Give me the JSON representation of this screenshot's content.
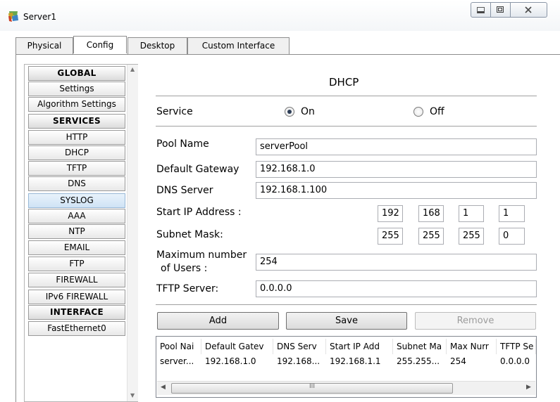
{
  "window": {
    "title": "Server1",
    "icon": "server-app-icon",
    "controls": [
      "minimize-icon",
      "maximize-icon",
      "close-icon"
    ]
  },
  "tabs": [
    {
      "label": "Physical"
    },
    {
      "label": "Config",
      "active": true
    },
    {
      "label": "Desktop"
    },
    {
      "label": "Custom Interface"
    }
  ],
  "sidebar": {
    "items": [
      {
        "label": "GLOBAL",
        "kind": "header"
      },
      {
        "label": "Settings",
        "kind": "item"
      },
      {
        "label": "Algorithm Settings",
        "kind": "item"
      },
      {
        "label": "SERVICES",
        "kind": "header"
      },
      {
        "label": "HTTP",
        "kind": "item"
      },
      {
        "label": "DHCP",
        "kind": "item"
      },
      {
        "label": "TFTP",
        "kind": "item"
      },
      {
        "label": "DNS",
        "kind": "item"
      },
      {
        "label": "SYSLOG",
        "kind": "item"
      },
      {
        "label": "AAA",
        "kind": "item"
      },
      {
        "label": "NTP",
        "kind": "item"
      },
      {
        "label": "EMAIL",
        "kind": "item"
      },
      {
        "label": "FTP",
        "kind": "item"
      },
      {
        "label": "FIREWALL",
        "kind": "item"
      },
      {
        "label": "IPv6 FIREWALL",
        "kind": "item"
      },
      {
        "label": "INTERFACE",
        "kind": "header"
      },
      {
        "label": "FastEthernet0",
        "kind": "item"
      }
    ]
  },
  "dhcp": {
    "heading": "DHCP",
    "service_label": "Service",
    "service_on_label": "On",
    "service_off_label": "Off",
    "service_state": "On",
    "pool_name_label": "Pool Name",
    "pool_name_value": "serverPool",
    "default_gateway_label": "Default Gateway",
    "default_gateway_value": "192.168.1.0",
    "dns_server_label": "DNS Server",
    "dns_server_value": "192.168.1.100",
    "start_ip_label": "Start IP Address :",
    "start_ip_octets": [
      "192",
      "168",
      "1",
      "1"
    ],
    "subnet_mask_label": "Subnet Mask:",
    "subnet_mask_octets": [
      "255",
      "255",
      "255",
      "0"
    ],
    "max_users_label_line1": "Maximum number",
    "max_users_label_line2": "of Users :",
    "max_users_value": "254",
    "tftp_server_label": "TFTP Server:",
    "tftp_server_value": "0.0.0.0",
    "add_button": "Add",
    "save_button": "Save",
    "remove_button": "Remove"
  },
  "pool_table": {
    "columns": [
      "Pool Nai",
      "Default Gatev",
      "DNS Serv",
      "Start IP Add",
      "Subnet Ma",
      "Max Nurr",
      "TFTP Se"
    ],
    "rows": [
      [
        "server...",
        "192.168.1.0",
        "192.168...",
        "192.168.1.1",
        "255.255...",
        "254",
        "0.0.0.0"
      ]
    ],
    "scroll_grip": "III"
  }
}
